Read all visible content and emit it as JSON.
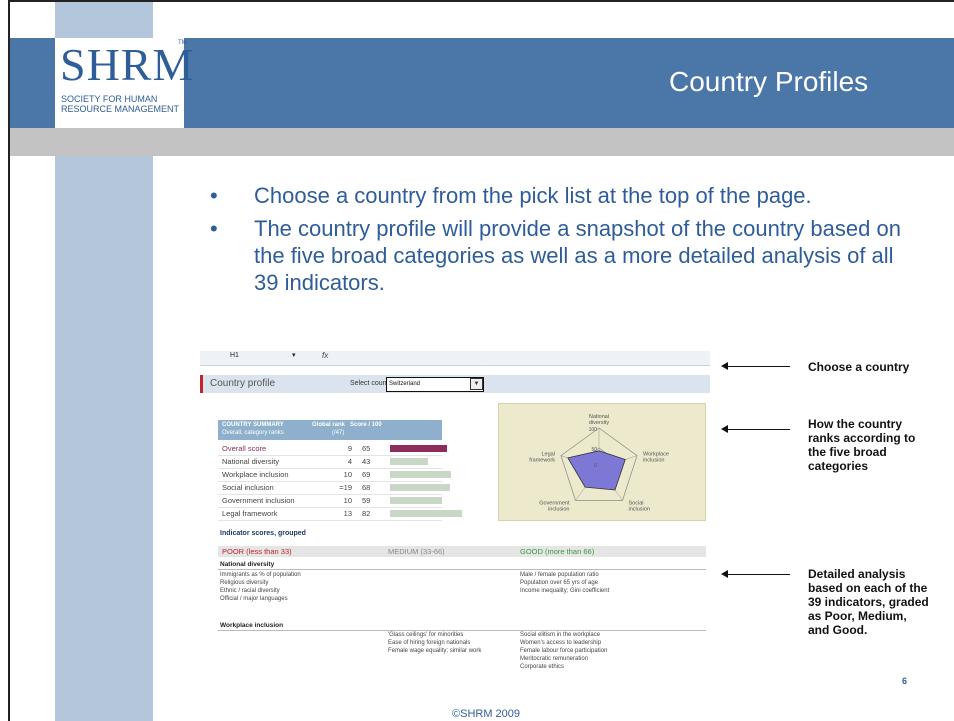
{
  "logo": {
    "main": "SHRM",
    "tm": "TM",
    "sub_line1": "SOCIETY FOR HUMAN",
    "sub_line2": "RESOURCE MANAGEMENT"
  },
  "title": "Country Profiles",
  "bullets": [
    "Choose a country from the pick list at the top of the page.",
    "The country profile will provide a snapshot of the country based on the five broad categories as well as a more detailed analysis of all 39 indicators."
  ],
  "bullet_glyph": "•",
  "screenshot": {
    "cell_ref": "H1",
    "fx": "fx",
    "panel_title": "Country profile",
    "select_label": "Select country:",
    "select_value": "Switzerland",
    "select_arrow": "▼",
    "summary_header": {
      "title": "COUNTRY SUMMARY",
      "subtitle": "Overall, category ranks",
      "global_rank": "Global rank",
      "of": "(/47)",
      "score": "Score / 100"
    },
    "summary_rows": [
      {
        "label": "Overall score",
        "rank": "9",
        "score": "65",
        "value": 65
      },
      {
        "label": "National diversity",
        "rank": "4",
        "score": "43",
        "value": 43
      },
      {
        "label": "Workplace inclusion",
        "rank": "10",
        "score": "69",
        "value": 69
      },
      {
        "label": "Social inclusion",
        "rank": "=19",
        "score": "68",
        "value": 68
      },
      {
        "label": "Government inclusion",
        "rank": "10",
        "score": "59",
        "value": 59
      },
      {
        "label": "Legal framework",
        "rank": "13",
        "score": "82",
        "value": 82
      }
    ],
    "radar": {
      "axes": [
        "National diversity",
        "Workplace inclusion",
        "Social inclusion",
        "Government inclusion",
        "Legal framework"
      ],
      "ticks": [
        "100",
        "50",
        "0"
      ]
    },
    "indicator_title": "Indicator scores, grouped",
    "grades": {
      "poor": "POOR (less than 33)",
      "medium": "MEDIUM (33-66)",
      "good": "GOOD (more than 66)"
    },
    "sections": [
      {
        "title": "National diversity",
        "poor": [
          "Immigrants as % of population",
          "Religious diversity",
          "Ethnic / racial diversity",
          "Official / major languages"
        ],
        "medium": [],
        "good": [
          "Male / female population ratio",
          "Population over 65 yrs of age",
          "Income inequality; Gini coefficient"
        ]
      },
      {
        "title": "Workplace inclusion",
        "poor": [],
        "medium": [
          "'Glass ceilings' for minorities",
          "Ease of hiring foreign nationals",
          "Female wage equality; similar work"
        ],
        "good": [
          "Social elitism in the workplace",
          "Women's access to leadership",
          "Female labour force participation",
          "Meritocratic remuneration",
          "Corporate ethics"
        ]
      }
    ]
  },
  "annotations": {
    "choose": "Choose a country",
    "ranks": [
      "How the country",
      "ranks according to",
      "the five broad",
      "categories"
    ],
    "detail": [
      "Detailed analysis",
      "based on each of the",
      "39 indicators, graded",
      "as Poor, Medium,",
      "and Good."
    ]
  },
  "footer": "©SHRM 2009",
  "page_number": "6",
  "colors": {
    "band_blue": "#4a76a8",
    "strip_blue": "#b3c6dc",
    "band_gray": "#c3c3c3",
    "text_blue": "#2e5d9a",
    "overall_bar": "#8e2c5c",
    "category_bar": "#c9d8c6",
    "poor": "#c0242c",
    "good": "#3a9a3a"
  }
}
